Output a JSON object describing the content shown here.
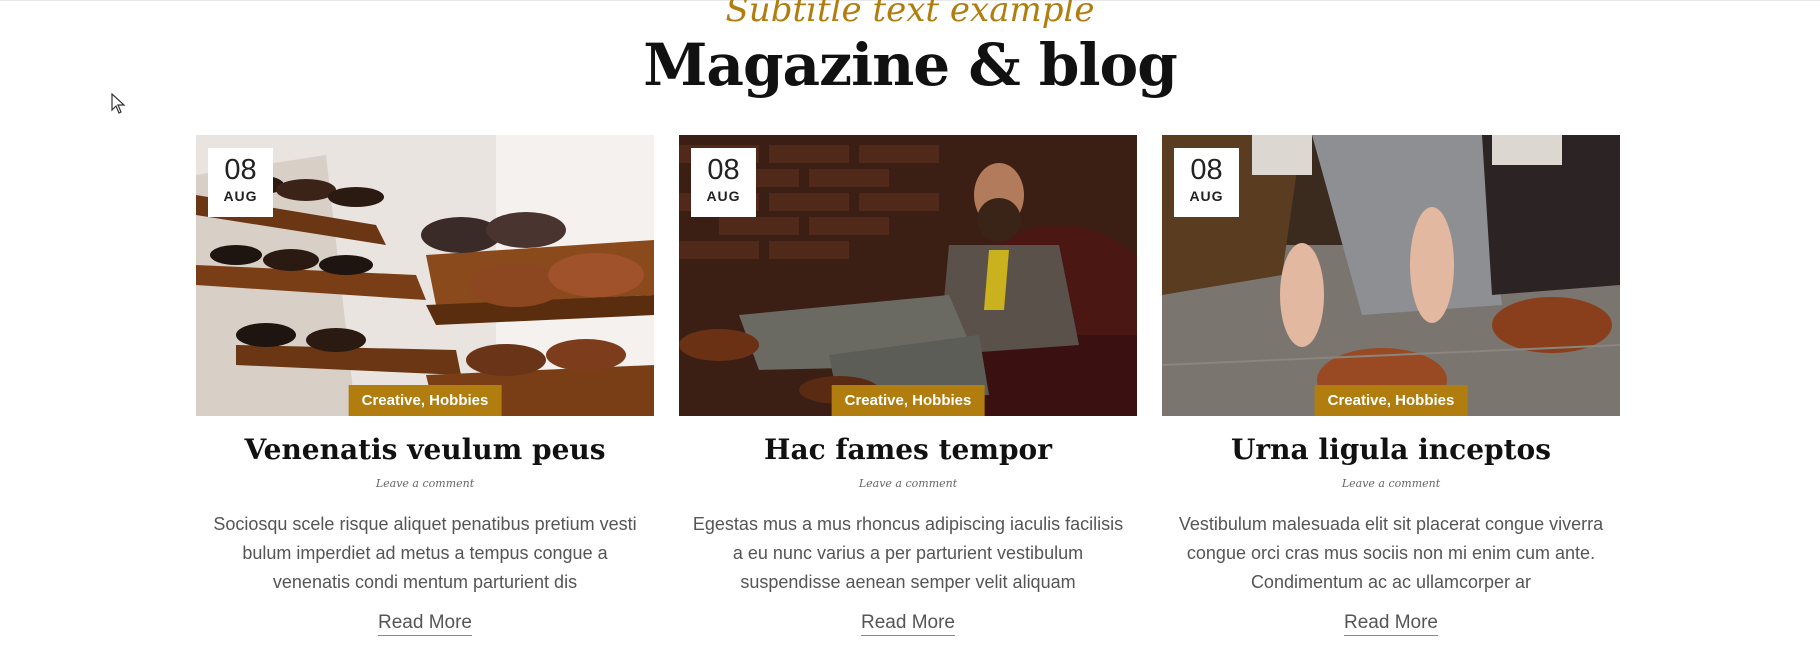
{
  "header": {
    "subtitle": "Subtitle text example",
    "title": "Magazine & blog"
  },
  "posts": [
    {
      "date_day": "08",
      "date_month": "AUG",
      "categories": "Creative, Hobbies",
      "title": "Venenatis veulum peus",
      "meta": "Leave a comment",
      "excerpt": "Sociosqu scele risque aliquet penatibus pretium vesti bulum imperdiet ad metus a tempus congue a venenatis condi mentum parturient dis",
      "read_more": "Read More",
      "image": "shoe-shelf-photo"
    },
    {
      "date_day": "08",
      "date_month": "AUG",
      "categories": "Creative, Hobbies",
      "title": "Hac fames tempor",
      "meta": "Leave a comment",
      "excerpt": "Egestas mus a mus rhoncus adipiscing iaculis facilisis a eu nunc varius a per parturient vestibulum suspendisse aenean semper velit aliquam",
      "read_more": "Read More",
      "image": "bearded-man-chair-photo"
    },
    {
      "date_day": "08",
      "date_month": "AUG",
      "categories": "Creative, Hobbies",
      "title": "Urna ligula inceptos",
      "meta": "Leave a comment",
      "excerpt": "Vestibulum malesuada elit sit placerat congue viverra congue orci cras mus sociis non mi enim cum ante. Condimentum ac ac ullamcorper ar",
      "read_more": "Read More",
      "image": "tying-shoes-photo"
    }
  ],
  "colors": {
    "accent": "#b07d0e",
    "title": "#111111",
    "text": "#555555"
  }
}
